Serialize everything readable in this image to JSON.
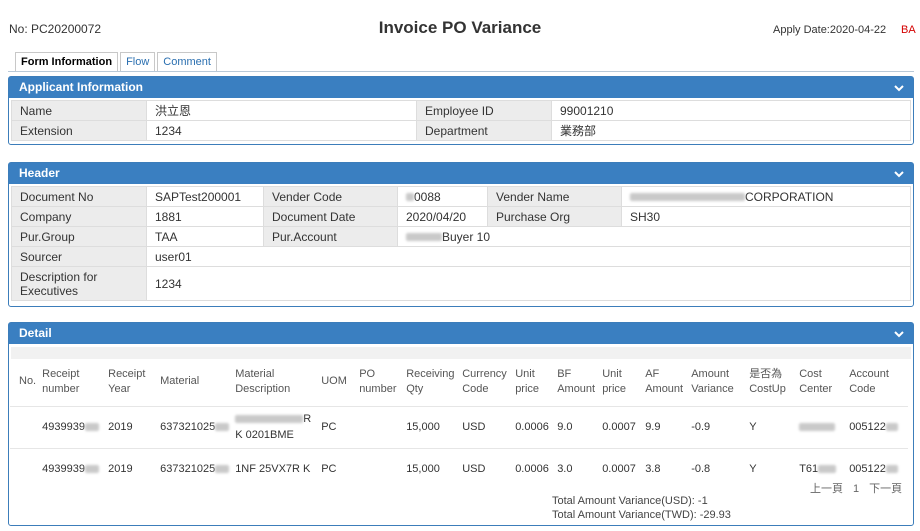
{
  "header": {
    "doc_no": "No: PC20200072",
    "title": "Invoice PO Variance",
    "apply_date": "Apply Date:2020-04-22",
    "ba": "BA"
  },
  "tabs": [
    "Form Information",
    "Flow",
    "Comment"
  ],
  "applicant": {
    "section_title": "Applicant Information",
    "name_label": "Name",
    "name": "洪立恩",
    "employee_id_label": "Employee ID",
    "employee_id": "99001210",
    "extension_label": "Extension",
    "extension": "1234",
    "department_label": "Department",
    "department": "業務部"
  },
  "doc_header": {
    "section_title": "Header",
    "document_no_label": "Document No",
    "document_no": "SAPTest200001",
    "vender_code_label": "Vender Code",
    "vender_code": "0088",
    "vender_name_label": "Vender Name",
    "vender_name": "CORPORATION",
    "company_label": "Company",
    "company": "1881",
    "document_date_label": "Document Date",
    "document_date": "2020/04/20",
    "purchase_org_label": "Purchase Org",
    "purchase_org": "SH30",
    "pur_group_label": "Pur.Group",
    "pur_group": "TAA",
    "pur_account_label": "Pur.Account",
    "pur_account": "Buyer 10",
    "sourcer_label": "Sourcer",
    "sourcer": "user01",
    "description_label": "Description for Executives",
    "description": "1234"
  },
  "detail": {
    "section_title": "Detail",
    "columns": [
      "No.",
      "Receipt number",
      "Receipt Year",
      "Material",
      "Material Description",
      "UOM",
      "PO number",
      "Receiving Qty",
      "Currency Code",
      "Unit price",
      "BF Amount",
      "Unit price",
      "AF Amount",
      "Amount Variance",
      "是否為 CostUp",
      "Cost Center",
      "Account Code"
    ],
    "rows": [
      {
        "no": "",
        "receipt_number": "4939939",
        "receipt_year": "2019",
        "material": "637321025",
        "desc_1": "R",
        "desc_2": "K 0201BME",
        "uom": "PC",
        "po_number": "",
        "qty": "15,000",
        "currency": "USD",
        "unit_price_bf": "0.0006",
        "bf_amount": "9.0",
        "unit_price_af": "0.0007",
        "af_amount": "9.9",
        "variance": "-0.9",
        "cost_up": "Y",
        "cost_center": "",
        "account_code": "005122"
      },
      {
        "no": "",
        "receipt_number": "4939939",
        "receipt_year": "2019",
        "material": "637321025",
        "desc_1": "1NF 25VX7R K",
        "desc_2": "",
        "uom": "PC",
        "po_number": "",
        "qty": "15,000",
        "currency": "USD",
        "unit_price_bf": "0.0006",
        "bf_amount": "3.0",
        "unit_price_af": "0.0007",
        "af_amount": "3.8",
        "variance": "-0.8",
        "cost_up": "Y",
        "cost_center": "T61",
        "account_code": "005122"
      }
    ],
    "pager_prev": "上一頁",
    "pager_page": "1",
    "pager_next": "下一頁",
    "total_usd": "Total Amount Variance(USD): -1",
    "total_twd": "Total Amount Variance(TWD): -29.93"
  },
  "colors": {
    "header_bar": "#3a7fc1",
    "accent_red": "#d40000",
    "label_bg": "#ececec"
  }
}
